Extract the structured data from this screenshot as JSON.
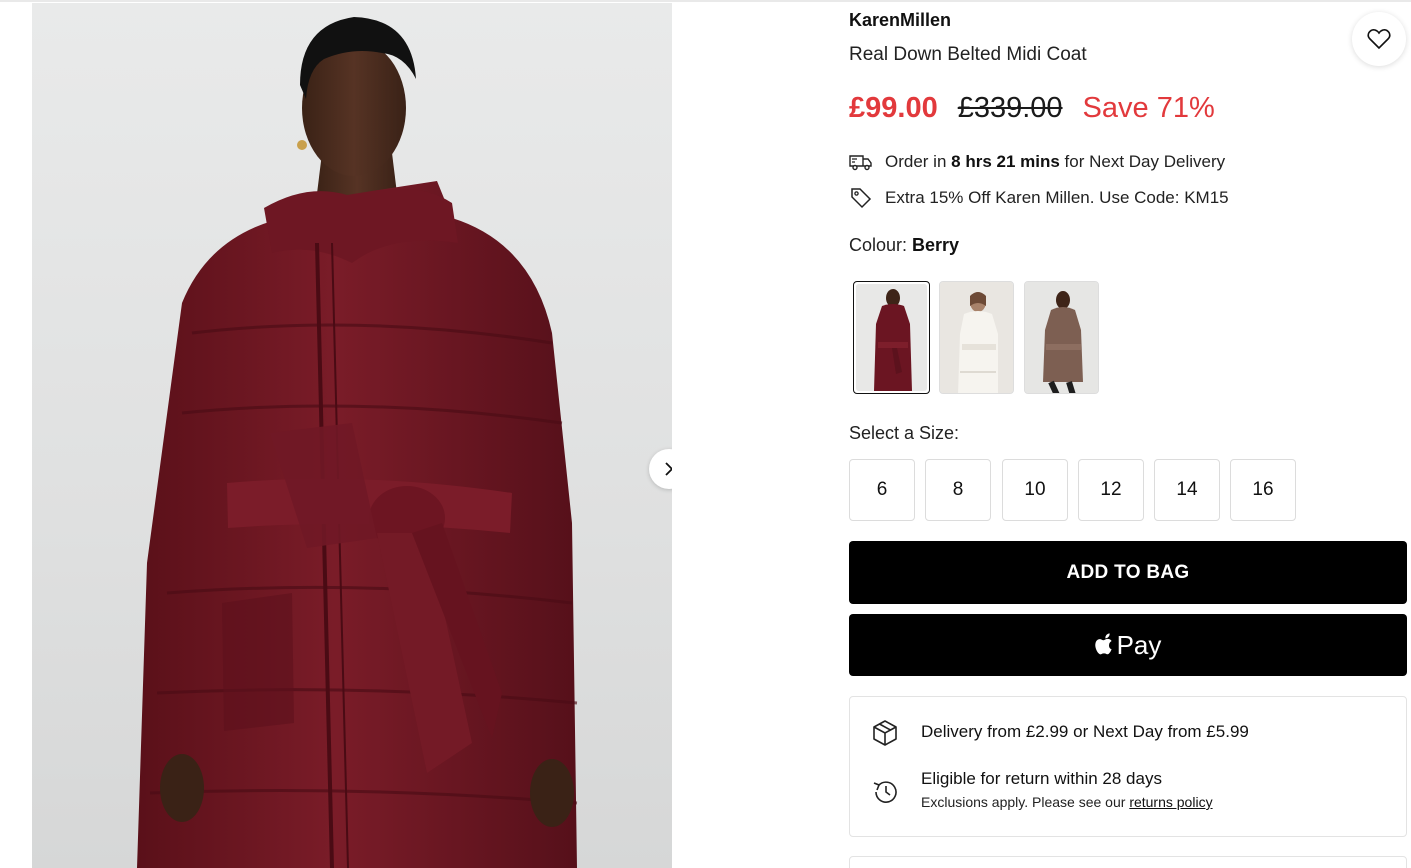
{
  "product": {
    "brand": "KarenMillen",
    "title": "Real Down Belted Midi Coat",
    "price_now": "£99.00",
    "price_was": "£339.00",
    "price_save": "Save 71%"
  },
  "delivery_line": {
    "prefix": "Order in ",
    "time": "8 hrs 21 mins",
    "suffix": " for Next Day Delivery",
    "icon": "delivery-truck-icon"
  },
  "promo_line": {
    "text": "Extra 15% Off Karen Millen. Use Code: KM15",
    "icon": "price-tag-icon"
  },
  "colour": {
    "label": "Colour: ",
    "selected": "Berry",
    "swatches": [
      {
        "name": "Berry",
        "color": "#6b1522",
        "selected": true
      },
      {
        "name": "White",
        "color": "#f1efe9",
        "selected": false
      },
      {
        "name": "Brown",
        "color": "#7d5f52",
        "selected": false
      }
    ]
  },
  "size": {
    "label": "Select a Size:",
    "options": [
      "6",
      "8",
      "10",
      "12",
      "14",
      "16"
    ]
  },
  "buttons": {
    "add_to_bag": "ADD TO BAG",
    "apple_pay": "Pay"
  },
  "info": {
    "delivery": "Delivery from £2.99 or Next Day from £5.99",
    "returns_title": "Eligible for return within 28 days",
    "returns_sub": "Exclusions apply. Please see our ",
    "returns_link": "returns policy"
  },
  "colors": {
    "sale_red": "#e2393c",
    "coat_berry": "#6b1522",
    "button_black": "#000000"
  }
}
